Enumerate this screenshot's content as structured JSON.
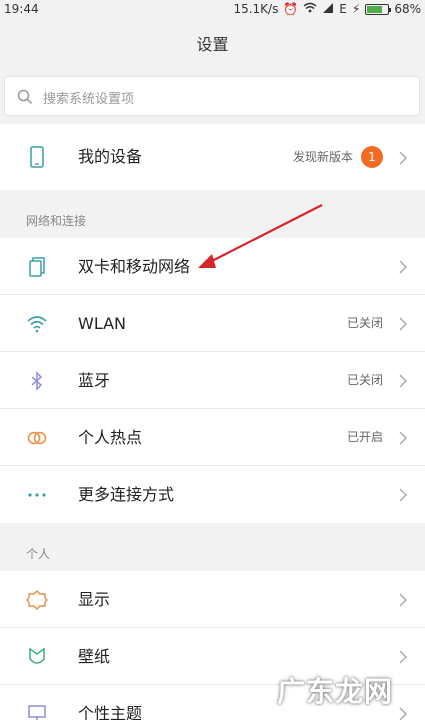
{
  "status": {
    "time": "19:44",
    "speed": "15.1K/s",
    "network": "E",
    "battery": "68%"
  },
  "header": {
    "title": "设置"
  },
  "search": {
    "placeholder": "搜索系统设置项"
  },
  "device": {
    "label": "我的设备",
    "value": "发现新版本",
    "badge": "1"
  },
  "sections": {
    "network": "网络和连接",
    "personal": "个人"
  },
  "network_items": [
    {
      "label": "双卡和移动网络",
      "value": "",
      "icon": "sim-card-icon"
    },
    {
      "label": "WLAN",
      "value": "已关闭",
      "icon": "wifi-icon"
    },
    {
      "label": "蓝牙",
      "value": "已关闭",
      "icon": "bluetooth-icon"
    },
    {
      "label": "个人热点",
      "value": "已开启",
      "icon": "hotspot-icon"
    },
    {
      "label": "更多连接方式",
      "value": "",
      "icon": "more-dots-icon"
    }
  ],
  "personal_items": [
    {
      "label": "显示",
      "icon": "sun-icon"
    },
    {
      "label": "壁纸",
      "icon": "wallpaper-icon"
    },
    {
      "label": "个性主题",
      "icon": "theme-icon"
    }
  ],
  "watermark": "广东龙网",
  "colors": {
    "accent_orange": "#f26b22",
    "icon_teal": "#3aa0a6",
    "arrow_red": "#d8252b",
    "battery_green": "#4cae4c"
  }
}
